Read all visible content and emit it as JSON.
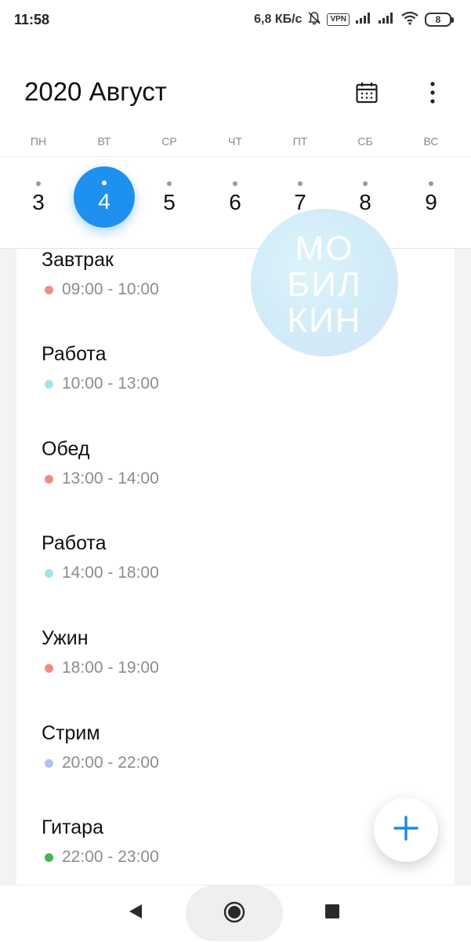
{
  "status_bar": {
    "time": "11:58",
    "speed": "6,8 КБ/с",
    "vpn": "VPN",
    "battery": "8",
    "icons": [
      "bell-off-icon",
      "vpn-icon",
      "signal-icon",
      "signal-icon",
      "wifi-icon",
      "battery-icon"
    ]
  },
  "header": {
    "title": "2020 Август",
    "calendar_icon": "calendar-icon",
    "more_icon": "more-vertical-icon"
  },
  "weekdays": [
    "ПН",
    "ВТ",
    "СР",
    "ЧТ",
    "ПТ",
    "СБ",
    "ВС"
  ],
  "dates": [
    {
      "day": "3",
      "selected": false
    },
    {
      "day": "4",
      "selected": true
    },
    {
      "day": "5",
      "selected": false
    },
    {
      "day": "6",
      "selected": false
    },
    {
      "day": "7",
      "selected": false
    },
    {
      "day": "8",
      "selected": false
    },
    {
      "day": "9",
      "selected": false
    }
  ],
  "events": [
    {
      "title": "Завтрак",
      "time": "09:00 - 10:00",
      "color": "#f28b82"
    },
    {
      "title": "Работа",
      "time": "10:00 - 13:00",
      "color": "#a6e3e9"
    },
    {
      "title": "Обед",
      "time": "13:00 - 14:00",
      "color": "#f28b82"
    },
    {
      "title": "Работа",
      "time": "14:00 - 18:00",
      "color": "#a6e3e9"
    },
    {
      "title": "Ужин",
      "time": "18:00 - 19:00",
      "color": "#f28b82"
    },
    {
      "title": "Стрим",
      "time": "20:00 - 22:00",
      "color": "#aec3f5"
    },
    {
      "title": "Гитара",
      "time": "22:00 - 23:00",
      "color": "#4caf50"
    }
  ],
  "watermark": {
    "lines": [
      "МО",
      "БИЛ",
      "КИН"
    ]
  },
  "fab": {
    "icon": "plus-icon",
    "color": "#1e88e5"
  },
  "nav": {
    "back_icon": "back-triangle-icon",
    "home_icon": "home-circle-icon",
    "recent_icon": "recent-square-icon"
  },
  "colors": {
    "accent": "#1e90f0",
    "text_secondary": "#8c8c8c"
  }
}
